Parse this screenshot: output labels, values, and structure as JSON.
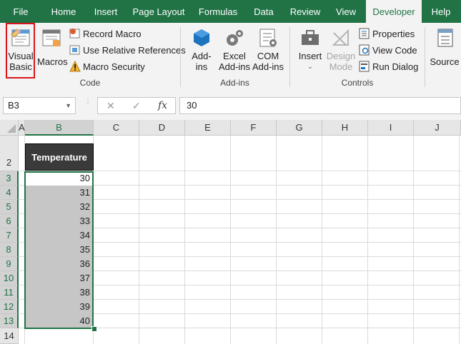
{
  "ribbon_tabs": [
    "File",
    "Home",
    "Insert",
    "Page Layout",
    "Formulas",
    "Data",
    "Review",
    "View",
    "Developer",
    "Help"
  ],
  "active_tab": "Developer",
  "code_group": {
    "label": "Code",
    "visual_basic": [
      "Visual",
      "Basic"
    ],
    "macros": "Macros",
    "record_macro": "Record Macro",
    "use_relative": "Use Relative References",
    "macro_security": "Macro Security"
  },
  "addins_group": {
    "label": "Add-ins",
    "addins": [
      "Add-",
      "ins"
    ],
    "excel_addins": [
      "Excel",
      "Add-ins"
    ],
    "com_addins": [
      "COM",
      "Add-ins"
    ]
  },
  "controls_group": {
    "label": "Controls",
    "insert": "Insert",
    "design_mode": [
      "Design",
      "Mode"
    ],
    "properties": "Properties",
    "view_code": "View Code",
    "run_dialog": "Run Dialog"
  },
  "source": "Source",
  "formula_bar": {
    "name_box": "B3",
    "value": "30",
    "fx": "fx"
  },
  "columns": [
    "A",
    "B",
    "C",
    "D",
    "E",
    "F",
    "G",
    "H",
    "I",
    "J"
  ],
  "rows": [
    "2",
    "3",
    "4",
    "5",
    "6",
    "7",
    "8",
    "9",
    "10",
    "11",
    "12",
    "13",
    "14"
  ],
  "table_header": "Temperature",
  "values": [
    "30",
    "31",
    "32",
    "33",
    "34",
    "35",
    "36",
    "37",
    "38",
    "39",
    "40"
  ],
  "colors": {
    "accent": "#217346",
    "highlight": "#d9161c",
    "selection_fill": "#c6c6c6"
  }
}
